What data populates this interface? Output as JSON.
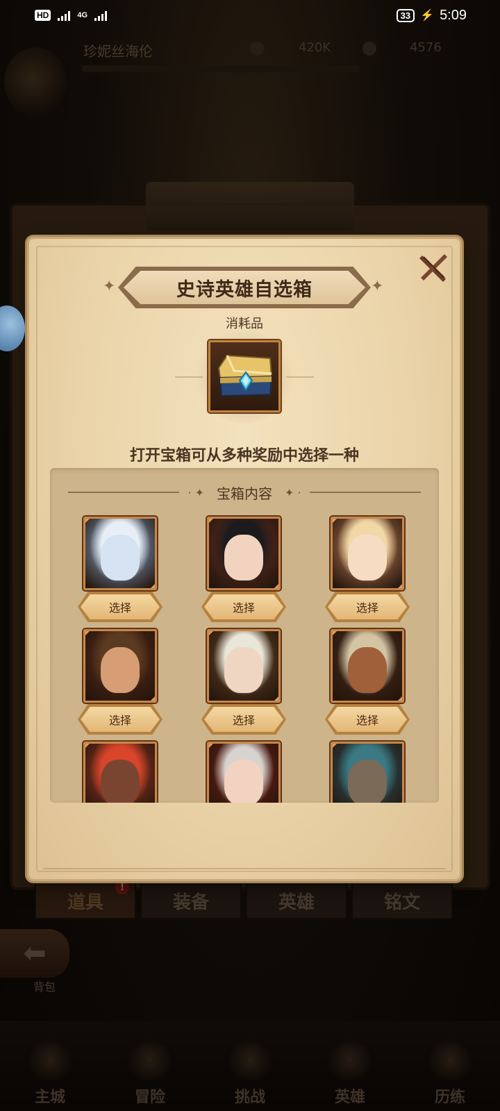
{
  "status_bar": {
    "hd_label": "HD",
    "hd_sub": "2",
    "net_label": "4G",
    "battery": "33",
    "time": "5:09"
  },
  "background": {
    "player_name": "珍妮丝海伦",
    "gold": "420K",
    "gems": "4576",
    "board_title": "背包",
    "tabs": [
      {
        "label": "道具",
        "badge": "!"
      },
      {
        "label": "装备"
      },
      {
        "label": "英雄"
      },
      {
        "label": "铭文"
      }
    ],
    "back_label": "背包",
    "nav": [
      "主城",
      "冒险",
      "挑战",
      "英雄",
      "历练"
    ]
  },
  "dialog": {
    "title": "史诗英雄自选箱",
    "category": "消耗品",
    "description": "打开宝箱可从多种奖励中选择一种",
    "contents_title": "宝箱内容",
    "select_label": "选择",
    "heroes": [
      {
        "name": "ice-queen",
        "bg": "#8fb6e0",
        "skin": "#d6e3f2",
        "hair": "#e8eef6"
      },
      {
        "name": "nun",
        "bg": "#6a3326",
        "skin": "#f1d3bf",
        "hair": "#1c1a1d"
      },
      {
        "name": "golden-lady",
        "bg": "#c9855b",
        "skin": "#f6dcc2",
        "hair": "#f1d8a6"
      },
      {
        "name": "ranger",
        "bg": "#5a2d1b",
        "skin": "#d79d74",
        "hair": "#5b3a22"
      },
      {
        "name": "white-assassin",
        "bg": "#6d4a2a",
        "skin": "#efd6c2",
        "hair": "#e9e6da"
      },
      {
        "name": "minotaur",
        "bg": "#4b2b1a",
        "skin": "#a0603a",
        "hair": "#d3c4a4"
      },
      {
        "name": "red-warrior",
        "bg": "#a33a25",
        "skin": "#7a4530",
        "hair": "#d8452a"
      },
      {
        "name": "red-hood",
        "bg": "#7a1f14",
        "skin": "#f2d2c0",
        "hair": "#d7d3cf"
      },
      {
        "name": "orc",
        "bg": "#2e5a66",
        "skin": "#7a6a57",
        "hair": "#3a7a84"
      }
    ]
  }
}
